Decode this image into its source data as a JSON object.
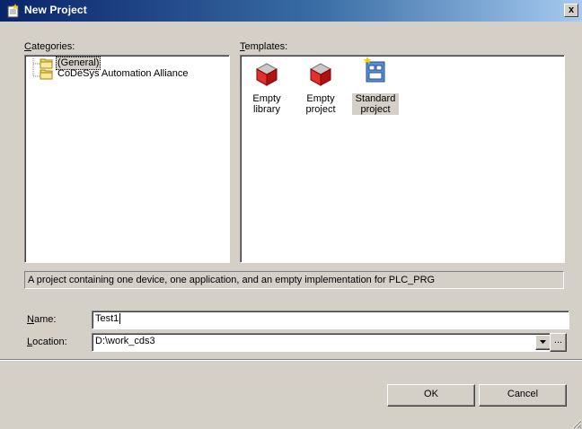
{
  "window": {
    "title": "New Project",
    "close_glyph": "x"
  },
  "categories": {
    "label_mnemonic": "C",
    "label_rest": "ategories:",
    "items": [
      {
        "label": "(General)",
        "selected": true
      },
      {
        "label": "CoDeSys Automation Alliance",
        "selected": false
      }
    ]
  },
  "templates": {
    "label_mnemonic": "T",
    "label_rest": "emplates:",
    "items": [
      {
        "line1": "Empty",
        "line2": "library",
        "icon": "red-cube-icon"
      },
      {
        "line1": "Empty",
        "line2": "project",
        "icon": "red-cube-icon"
      },
      {
        "line1": "Standard",
        "line2": "project",
        "icon": "standard-project-icon",
        "selected": true
      }
    ]
  },
  "description": "A project containing one device, one application, and an empty implementation for PLC_PRG",
  "name_field": {
    "label_mnemonic": "N",
    "label_rest": "ame:",
    "value": "Test1"
  },
  "location_field": {
    "label_mnemonic": "L",
    "label_rest": "ocation:",
    "value": "D:\\work_cds3",
    "browse_label": "..."
  },
  "buttons": {
    "ok": "OK",
    "cancel": "Cancel"
  },
  "colors": {
    "title_start": "#0a246a",
    "title_end": "#a6caf0",
    "dialog_bg": "#d4d0c8"
  }
}
